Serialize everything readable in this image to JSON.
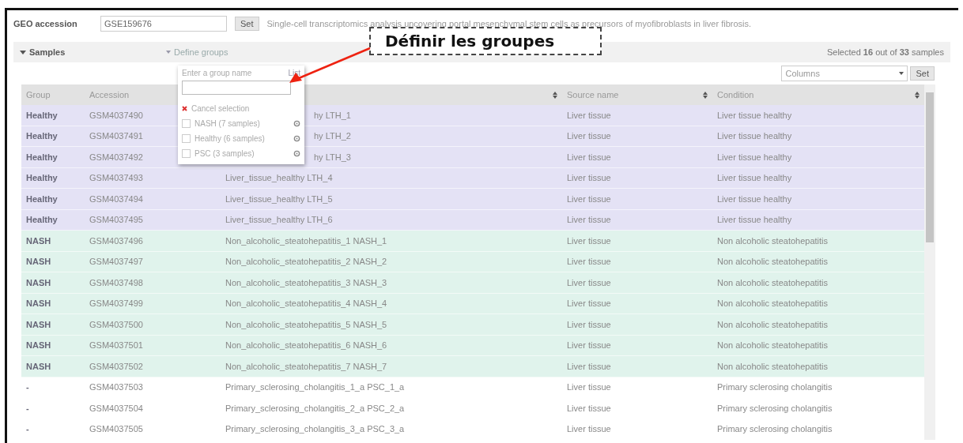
{
  "geo": {
    "label": "GEO accession",
    "value": "GSE159676",
    "button": "Set",
    "description": "Single-cell transcriptomics analysis uncovering portal mesenchymal stem cells as precursors of myofibroblasts in liver fibrosis."
  },
  "samples_bar": {
    "title": "Samples",
    "expanded": true,
    "define_groups": "Define groups",
    "selected_text": "Selected **16** out of **33** samples"
  },
  "columns_select": {
    "value": "Columns",
    "button": "Set"
  },
  "group_menu": {
    "prompt": "Enter a group name",
    "list_link": "List",
    "cancel": "Cancel selection",
    "groups": [
      {
        "label": "NASH (7 samples)",
        "checked": false
      },
      {
        "label": "Healthy (6 samples)",
        "checked": false
      },
      {
        "label": "PSC (3 samples)",
        "checked": false
      }
    ]
  },
  "annotation": {
    "text": "Définir les groupes"
  },
  "table": {
    "columns": [
      {
        "label": "Group"
      },
      {
        "label": "Accession"
      },
      {
        "sortable": true
      },
      {
        "label": "Source name",
        "sortable": true
      },
      {
        "label": "Condition",
        "sortable": true
      }
    ],
    "rows": [
      {
        "group": "Healthy",
        "accession": "GSM4037490",
        "title": "hy LTH_1",
        "covered": true,
        "source": "Liver tissue",
        "condition": "Liver tissue healthy",
        "color": "#e4e2f5"
      },
      {
        "group": "Healthy",
        "accession": "GSM4037491",
        "title": "hy LTH_2",
        "covered": true,
        "source": "Liver tissue",
        "condition": "Liver tissue healthy",
        "color": "#e4e2f5"
      },
      {
        "group": "Healthy",
        "accession": "GSM4037492",
        "title": "hy LTH_3",
        "covered": true,
        "source": "Liver tissue",
        "condition": "Liver tissue healthy",
        "color": "#e4e2f5"
      },
      {
        "group": "Healthy",
        "accession": "GSM4037493",
        "title": "Liver_tissue_healthy LTH_4",
        "covered": false,
        "source": "Liver tissue",
        "condition": "Liver tissue healthy",
        "color": "#e4e2f5"
      },
      {
        "group": "Healthy",
        "accession": "GSM4037494",
        "title": "Liver_tissue_healthy LTH_5",
        "covered": false,
        "source": "Liver tissue",
        "condition": "Liver tissue healthy",
        "color": "#e4e2f5"
      },
      {
        "group": "Healthy",
        "accession": "GSM4037495",
        "title": "Liver_tissue_healthy LTH_6",
        "covered": false,
        "source": "Liver tissue",
        "condition": "Liver tissue healthy",
        "color": "#e4e2f5"
      },
      {
        "group": "NASH",
        "accession": "GSM4037496",
        "title": "Non_alcoholic_steatohepatitis_1 NASH_1",
        "covered": false,
        "source": "Liver tissue",
        "condition": "Non alcoholic steatohepatitis",
        "color": "#e0f3ec"
      },
      {
        "group": "NASH",
        "accession": "GSM4037497",
        "title": "Non_alcoholic_steatohepatitis_2 NASH_2",
        "covered": false,
        "source": "Liver tissue",
        "condition": "Non alcoholic steatohepatitis",
        "color": "#e0f3ec"
      },
      {
        "group": "NASH",
        "accession": "GSM4037498",
        "title": "Non_alcoholic_steatohepatitis_3 NASH_3",
        "covered": false,
        "source": "Liver tissue",
        "condition": "Non alcoholic steatohepatitis",
        "color": "#e0f3ec"
      },
      {
        "group": "NASH",
        "accession": "GSM4037499",
        "title": "Non_alcoholic_steatohepatitis_4 NASH_4",
        "covered": false,
        "source": "Liver tissue",
        "condition": "Non alcoholic steatohepatitis",
        "color": "#e0f3ec"
      },
      {
        "group": "NASH",
        "accession": "GSM4037500",
        "title": "Non_alcoholic_steatohepatitis_5 NASH_5",
        "covered": false,
        "source": "Liver tissue",
        "condition": "Non alcoholic steatohepatitis",
        "color": "#e0f3ec"
      },
      {
        "group": "NASH",
        "accession": "GSM4037501",
        "title": "Non_alcoholic_steatohepatitis_6 NASH_6",
        "covered": false,
        "source": "Liver tissue",
        "condition": "Non alcoholic steatohepatitis",
        "color": "#e0f3ec"
      },
      {
        "group": "NASH",
        "accession": "GSM4037502",
        "title": "Non_alcoholic_steatohepatitis_7 NASH_7",
        "covered": false,
        "source": "Liver tissue",
        "condition": "Non alcoholic steatohepatitis",
        "color": "#e0f3ec"
      },
      {
        "group": "-",
        "accession": "GSM4037503",
        "title": "Primary_sclerosing_cholangitis_1_a PSC_1_a",
        "covered": false,
        "source": "Liver tissue",
        "condition": "Primary sclerosing cholangitis",
        "color": "#ffffff"
      },
      {
        "group": "-",
        "accession": "GSM4037504",
        "title": "Primary_sclerosing_cholangitis_2_a PSC_2_a",
        "covered": false,
        "source": "Liver tissue",
        "condition": "Primary sclerosing cholangitis",
        "color": "#ffffff"
      },
      {
        "group": "-",
        "accession": "GSM4037505",
        "title": "Primary_sclerosing_cholangitis_3_a PSC_3_a",
        "covered": false,
        "source": "Liver tissue",
        "condition": "Primary sclerosing cholangitis",
        "color": "#ffffff"
      }
    ]
  }
}
